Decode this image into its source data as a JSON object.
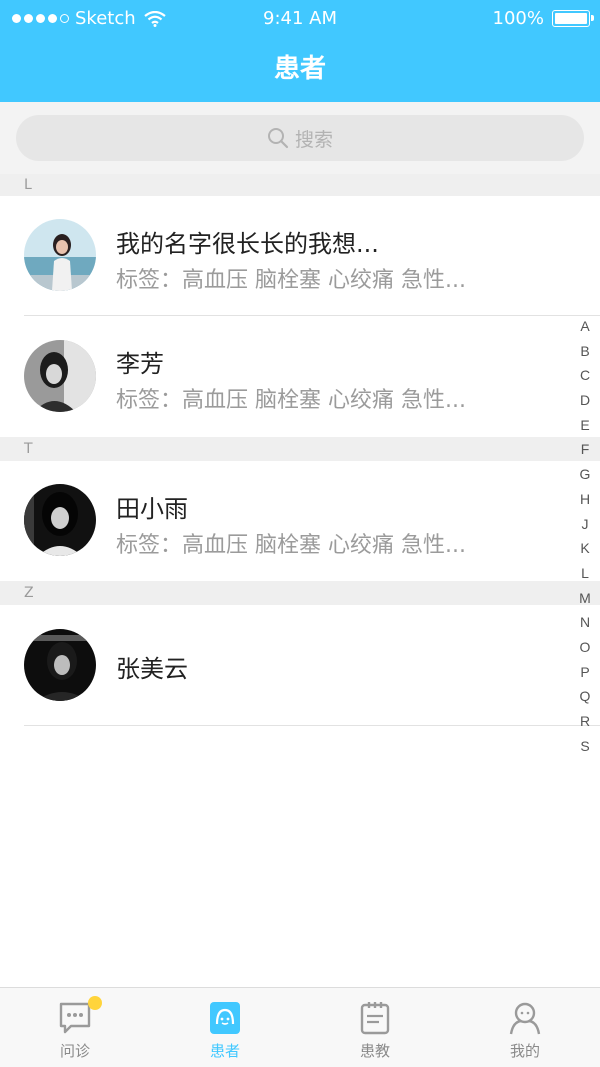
{
  "status_bar": {
    "carrier": "Sketch",
    "time": "9:41 AM",
    "battery": "100%"
  },
  "header": {
    "title": "患者"
  },
  "search": {
    "placeholder": "搜索"
  },
  "sections": [
    {
      "letter": "L",
      "patients": [
        {
          "name": "我的名字很长长的我想...",
          "tags": "标签：高血压  脑栓塞  心绞痛  急性..."
        },
        {
          "name": "李芳",
          "tags": "标签：高血压  脑栓塞  心绞痛  急性..."
        }
      ]
    },
    {
      "letter": "T",
      "patients": [
        {
          "name": "田小雨",
          "tags": "标签：高血压  脑栓塞  心绞痛  急性..."
        }
      ]
    },
    {
      "letter": "Z",
      "patients": [
        {
          "name": "张美云",
          "tags": ""
        }
      ]
    }
  ],
  "index_letters": [
    "A",
    "B",
    "C",
    "D",
    "E",
    "F",
    "G",
    "H",
    "J",
    "K",
    "L",
    "M",
    "N",
    "O",
    "P",
    "Q",
    "R",
    "S"
  ],
  "tabs": [
    {
      "label": "问诊",
      "icon": "chat-icon",
      "active": false,
      "badge": true
    },
    {
      "label": "患者",
      "icon": "patient-icon",
      "active": true,
      "badge": false
    },
    {
      "label": "患教",
      "icon": "notebook-icon",
      "active": false,
      "badge": false
    },
    {
      "label": "我的",
      "icon": "profile-icon",
      "active": false,
      "badge": false
    }
  ],
  "colors": {
    "accent": "#41c8ff",
    "badge": "#ffd43b"
  }
}
